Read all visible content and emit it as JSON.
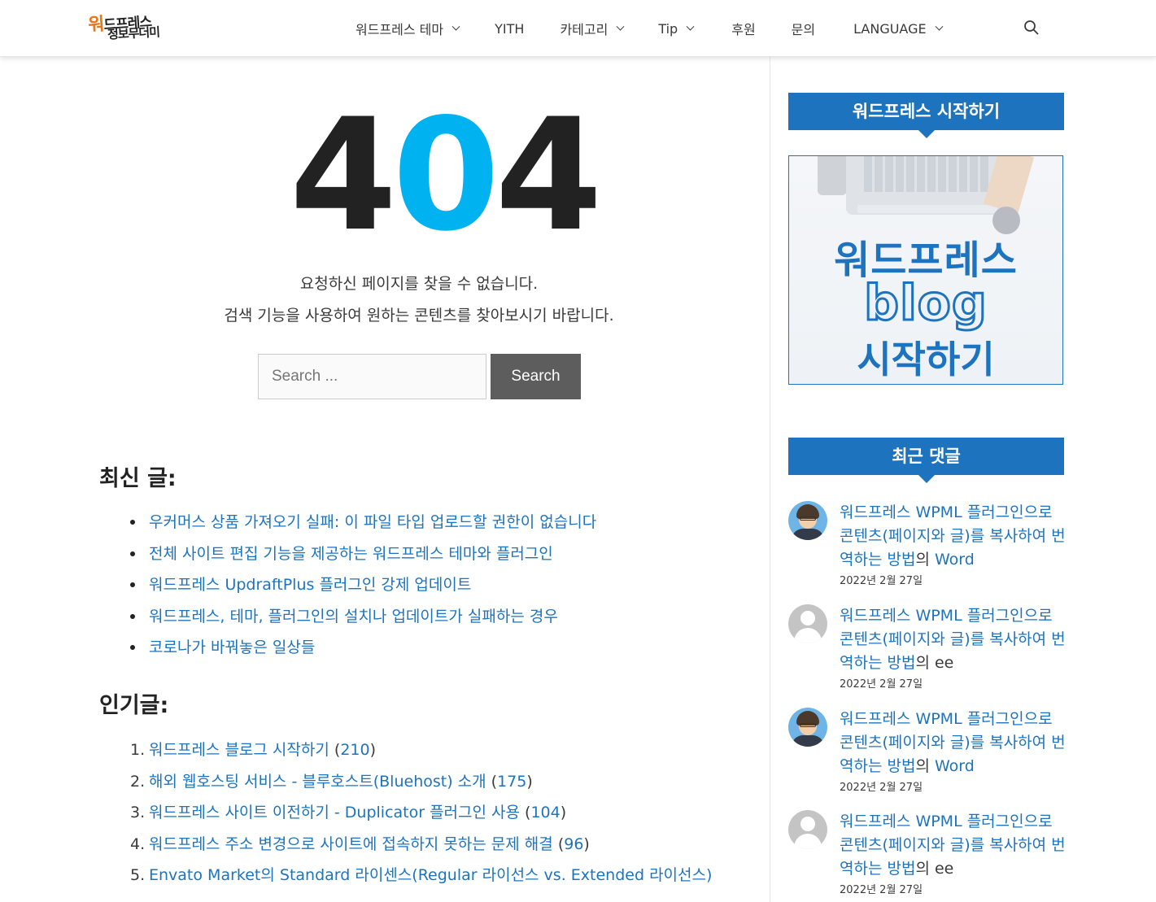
{
  "header": {
    "logo_line1_first": "워",
    "logo_line1_rest": "드프레스",
    "logo_line2": "정보무더미",
    "nav": [
      {
        "label": "워드프레스 테마",
        "dropdown": true
      },
      {
        "label": "YITH",
        "dropdown": false
      },
      {
        "label": "카테고리",
        "dropdown": true
      },
      {
        "label": "Tip",
        "dropdown": true
      },
      {
        "label": "후원",
        "dropdown": false
      },
      {
        "label": "문의",
        "dropdown": false
      },
      {
        "label": "LANGUAGE",
        "dropdown": true
      }
    ]
  },
  "error": {
    "d1": "4",
    "d2": "0",
    "d3": "4",
    "line1": "요청하신 페이지를 찾을 수 없습니다.",
    "line2": "검색 기능을 사용하여 원하는 콘텐츠를 찾아보시기 바랍니다."
  },
  "search": {
    "placeholder": "Search ...",
    "button": "Search"
  },
  "recent": {
    "title": "최신 글:",
    "items": [
      "우커머스 상품 가져오기 실패: 이 파일 타입 업로드할 권한이 없습니다",
      "전체 사이트 편집 기능을 제공하는 워드프레스 테마와 플러그인",
      "워드프레스 UpdraftPlus 플러그인 강제 업데이트",
      "워드프레스, 테마, 플러그인의 설치나 업데이트가 실패하는 경우",
      "코로나가 바꿔놓은 일상들"
    ]
  },
  "popular": {
    "title": "인기글:",
    "items": [
      {
        "num": "1.",
        "label": "워드프레스 블로그 시작하기",
        "count": "210"
      },
      {
        "num": "2.",
        "label": "해외 웹호스팅 서비스 - 블루호스트(Bluehost) 소개",
        "count": "175"
      },
      {
        "num": "3.",
        "label": "워드프레스 사이트 이전하기 - Duplicator 플러그인 사용",
        "count": "104"
      },
      {
        "num": "4.",
        "label": "워드프레스 주소 변경으로 사이트에 접속하지 못하는 문제 해결",
        "count": "96"
      },
      {
        "num": "5.",
        "label": "Envato Market의 Standard 라이센스(Regular 라이선스 vs. Extended 라이선스)",
        "count": ""
      }
    ]
  },
  "sidebar": {
    "widget1_title": "워드프레스 시작하기",
    "promo_line1": "워드프레스",
    "promo_line2": "blog",
    "promo_line3": "시작하기",
    "widget2_title": "최근 댓글",
    "comments": [
      {
        "post": "워드프레스 WPML 플러그인으로 콘텐츠(페이지와 글)를 복사하여 번역하는 방법",
        "sep": "의",
        "author": "Word",
        "author_link": true,
        "date": "2022년 2월 27일",
        "avatar": "face"
      },
      {
        "post": "워드프레스 WPML 플러그인으로 콘텐츠(페이지와 글)를 복사하여 번역하는 방법",
        "sep": "의",
        "author": "ee",
        "author_link": false,
        "date": "2022년 2월 27일",
        "avatar": "gray"
      },
      {
        "post": "워드프레스 WPML 플러그인으로 콘텐츠(페이지와 글)를 복사하여 번역하는 방법",
        "sep": "의",
        "author": "Word",
        "author_link": true,
        "date": "2022년 2월 27일",
        "avatar": "face"
      },
      {
        "post": "워드프레스 WPML 플러그인으로 콘텐츠(페이지와 글)를 복사하여 번역하는 방법",
        "sep": "의",
        "author": "ee",
        "author_link": false,
        "date": "2022년 2월 27일",
        "avatar": "gray"
      }
    ]
  },
  "colors": {
    "accent": "#1e73be",
    "highlight_zero": "#00b2f0",
    "search_button": "#5d5d5d"
  }
}
